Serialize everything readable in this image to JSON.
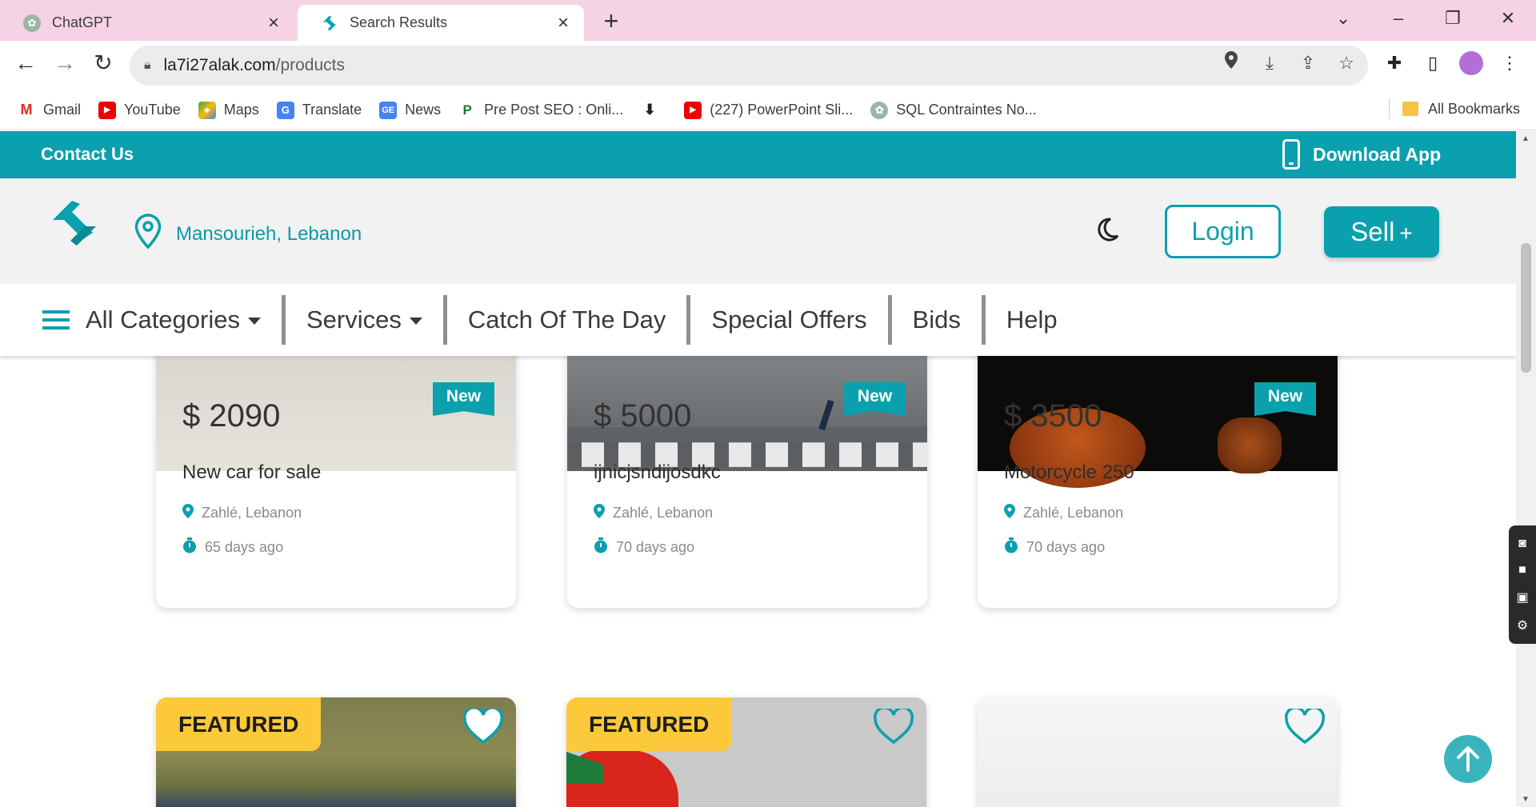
{
  "browser": {
    "tabs": [
      {
        "title": "ChatGPT",
        "active": false,
        "icon": "chatgpt-icon"
      },
      {
        "title": "Search Results",
        "active": true,
        "icon": "site-logo-icon"
      }
    ],
    "url_domain": "la7i27alak.com",
    "url_path": "/products",
    "bookmarks": [
      {
        "label": "Gmail",
        "icon": "gmail-icon"
      },
      {
        "label": "YouTube",
        "icon": "youtube-icon"
      },
      {
        "label": "Maps",
        "icon": "maps-icon"
      },
      {
        "label": "Translate",
        "icon": "translate-icon"
      },
      {
        "label": "News",
        "icon": "news-icon"
      },
      {
        "label": "Pre Post SEO : Onli...",
        "icon": "prepostseo-icon"
      },
      {
        "label": "",
        "icon": "download-icon"
      },
      {
        "label": "(227) PowerPoint Sli...",
        "icon": "youtube-icon"
      },
      {
        "label": "SQL Contraintes No...",
        "icon": "chatgpt-icon"
      }
    ],
    "all_bookmarks": "All Bookmarks"
  },
  "site": {
    "topbar": {
      "contact": "Contact Us",
      "download": "Download App"
    },
    "location": "Mansourieh, Lebanon",
    "login": "Login",
    "sell": "Sell",
    "nav": [
      "All Categories",
      "Services",
      "Catch Of The Day",
      "Special Offers",
      "Bids",
      "Help"
    ]
  },
  "colors": {
    "brand": "#0aa0ad",
    "featured": "#fcc93a"
  },
  "products": [
    {
      "price": "$ 2090",
      "badge": "New",
      "title": "New car for sale",
      "location": "Zahlé, Lebanon",
      "age": "65 days ago"
    },
    {
      "price": "$ 5000",
      "badge": "New",
      "title": "ijnicjsndijosdkc",
      "location": "Zahlé, Lebanon",
      "age": "70 days ago"
    },
    {
      "price": "$ 3500",
      "badge": "New",
      "title": "Motorcycle 250",
      "location": "Zahlé, Lebanon",
      "age": "70 days ago"
    }
  ],
  "featured_cards": [
    {
      "label": "FEATURED"
    },
    {
      "label": "FEATURED"
    },
    {
      "label": ""
    }
  ]
}
